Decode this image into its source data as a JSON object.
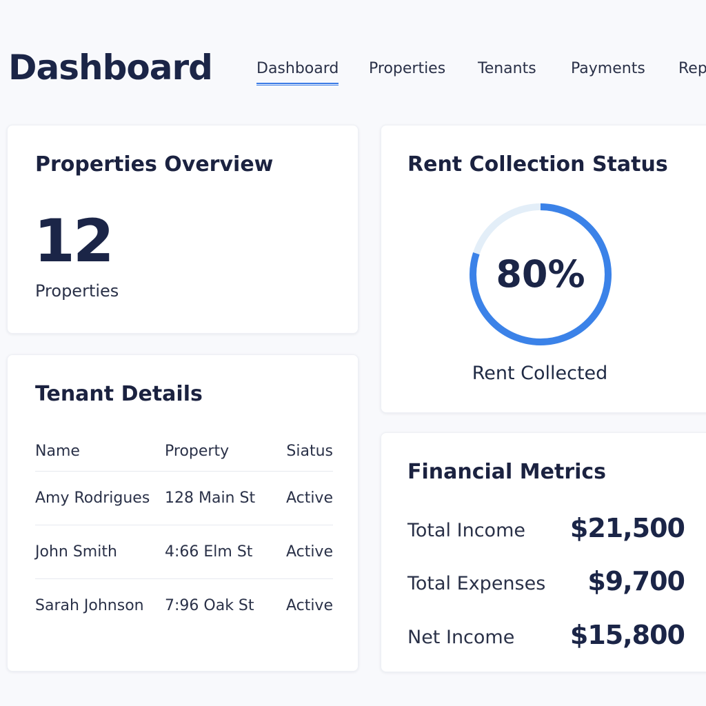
{
  "header": {
    "title": "Dashboard",
    "tabs": [
      {
        "label": "Dashboard",
        "active": true
      },
      {
        "label": "Properties",
        "active": false
      },
      {
        "label": "Tenants",
        "active": false
      },
      {
        "label": "Payments",
        "active": false
      },
      {
        "label": "Rep",
        "active": false
      }
    ]
  },
  "properties_overview": {
    "title": "Properties Overview",
    "count": "12",
    "count_label": "Properties"
  },
  "rent_collection": {
    "title": "Rent Collection Status",
    "percent_text": "80%",
    "percent_value": 0.8,
    "label": "Rent Collected"
  },
  "tenant_details": {
    "title": "Tenant Details",
    "columns": [
      "Name",
      "Property",
      "Siatus"
    ],
    "rows": [
      [
        "Amy Rodrigues",
        "128 Main St",
        "Active"
      ],
      [
        "John Smith",
        "4:66 Elm St",
        "Active"
      ],
      [
        "Sarah Johnson",
        "7:96 Oak St",
        "Active"
      ]
    ]
  },
  "financial_metrics": {
    "title": "Financial Metrics",
    "items": [
      {
        "label": "Total Income",
        "value": "$21,500"
      },
      {
        "label": "Total Expenses",
        "value": "$9,700"
      },
      {
        "label": "Net Income",
        "value": "$15,800"
      }
    ]
  },
  "colors": {
    "accent": "#3b82e8",
    "track": "#e3eef8",
    "text_dark": "#1b2547"
  }
}
